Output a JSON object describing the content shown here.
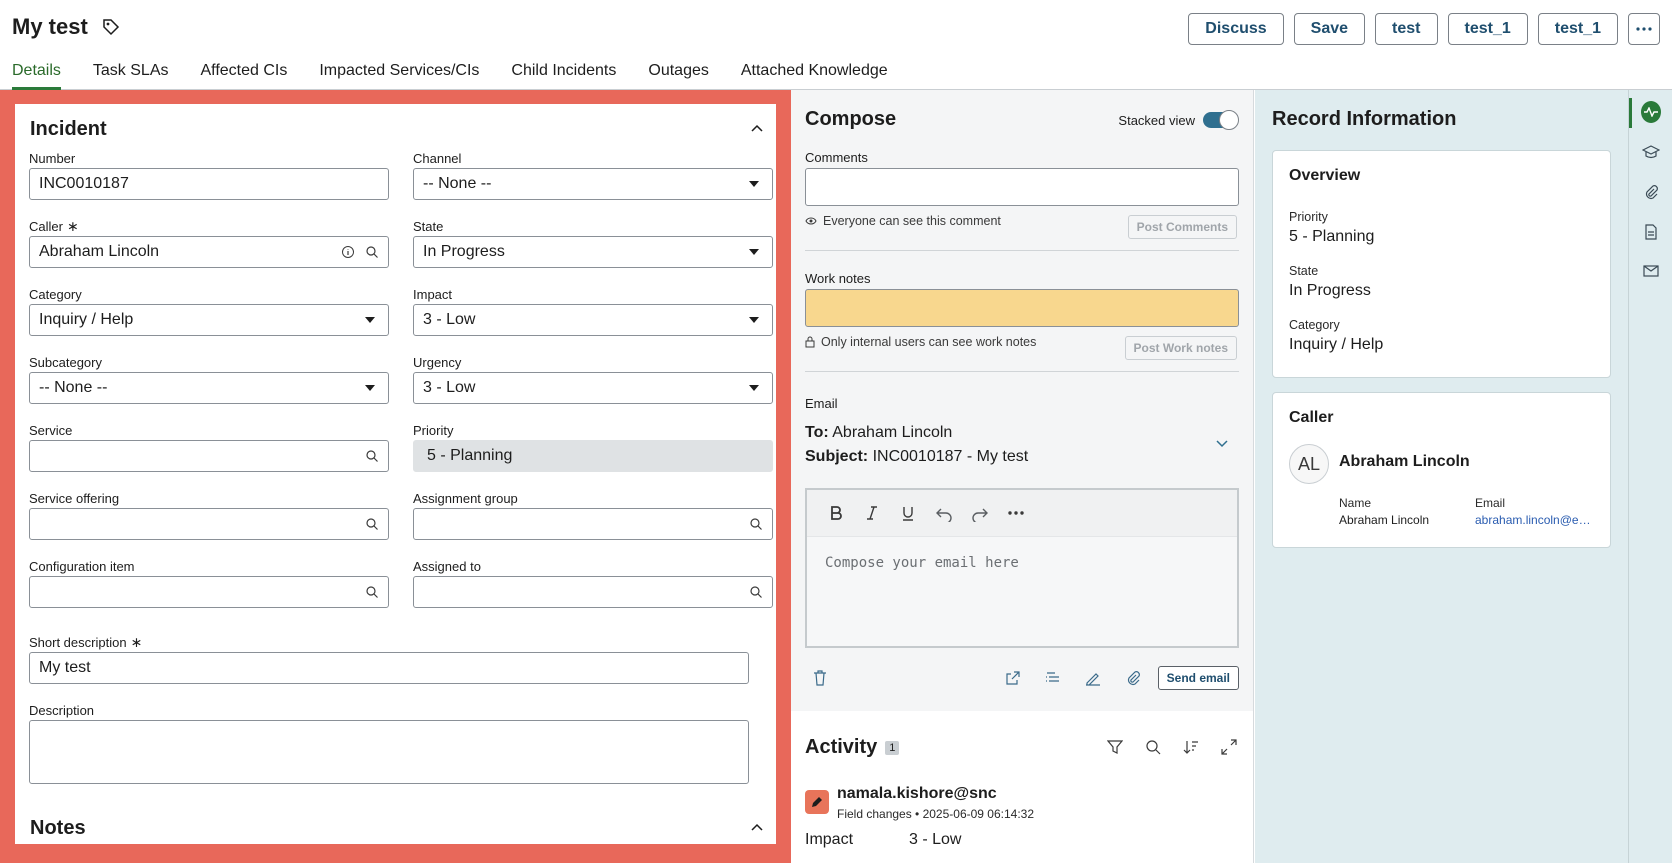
{
  "header": {
    "title": "My test",
    "buttons": [
      "Discuss",
      "Save",
      "test",
      "test_1",
      "test_1"
    ],
    "more_label": "..."
  },
  "tabs": [
    "Details",
    "Task SLAs",
    "Affected CIs",
    "Impacted Services/CIs",
    "Child Incidents",
    "Outages",
    "Attached Knowledge"
  ],
  "active_tab": "Details",
  "form": {
    "section_title": "Incident",
    "notes_title": "Notes",
    "required_mark": "∗",
    "number": {
      "label": "Number",
      "value": "INC0010187"
    },
    "channel": {
      "label": "Channel",
      "value": "-- None --"
    },
    "caller": {
      "label": "Caller",
      "value": "Abraham Lincoln"
    },
    "state": {
      "label": "State",
      "value": "In Progress"
    },
    "category": {
      "label": "Category",
      "value": "Inquiry / Help"
    },
    "impact": {
      "label": "Impact",
      "value": "3 - Low"
    },
    "subcategory": {
      "label": "Subcategory",
      "value": "-- None --"
    },
    "urgency": {
      "label": "Urgency",
      "value": "3 - Low"
    },
    "service": {
      "label": "Service",
      "value": ""
    },
    "priority": {
      "label": "Priority",
      "value": "5 - Planning"
    },
    "service_offering": {
      "label": "Service offering",
      "value": ""
    },
    "assignment_group": {
      "label": "Assignment group",
      "value": ""
    },
    "configuration_item": {
      "label": "Configuration item",
      "value": ""
    },
    "assigned_to": {
      "label": "Assigned to",
      "value": ""
    },
    "short_description": {
      "label": "Short description",
      "value": "My test"
    },
    "description": {
      "label": "Description",
      "value": ""
    }
  },
  "compose": {
    "title": "Compose",
    "stacked_view_label": "Stacked view",
    "stacked_view_on": true,
    "comments_label": "Comments",
    "comments_hint": "Everyone can see this comment",
    "post_comments": "Post Comments",
    "work_notes_label": "Work notes",
    "work_notes_hint": "Only internal users can see work notes",
    "post_work_notes": "Post Work notes",
    "email_label": "Email",
    "to_label": "To:",
    "to_value": "Abraham Lincoln",
    "subject_label": "Subject:",
    "subject_value": "INC0010187 - My test",
    "editor_placeholder": "Compose your email here",
    "send_email": "Send email"
  },
  "activity": {
    "title": "Activity",
    "count": "1",
    "user": "namala.kishore@snc",
    "meta": "Field changes • 2025-06-09 06:14:32",
    "field": "Impact",
    "value": "3 - Low"
  },
  "record_info": {
    "title": "Record Information",
    "overview_title": "Overview",
    "priority_label": "Priority",
    "priority_value": "5 - Planning",
    "state_label": "State",
    "state_value": "In Progress",
    "category_label": "Category",
    "category_value": "Inquiry / Help",
    "caller_title": "Caller",
    "caller_initials": "AL",
    "caller_name": "Abraham Lincoln",
    "name_label": "Name",
    "name_value": "Abraham Lincoln",
    "email_label": "Email",
    "email_value": "abraham.lincoln@example.com"
  },
  "colors": {
    "accent_green": "#2a7a3a",
    "highlight_red": "#e8685a",
    "work_notes_yellow": "#f8d78e",
    "link_blue": "#2a5cb0"
  }
}
